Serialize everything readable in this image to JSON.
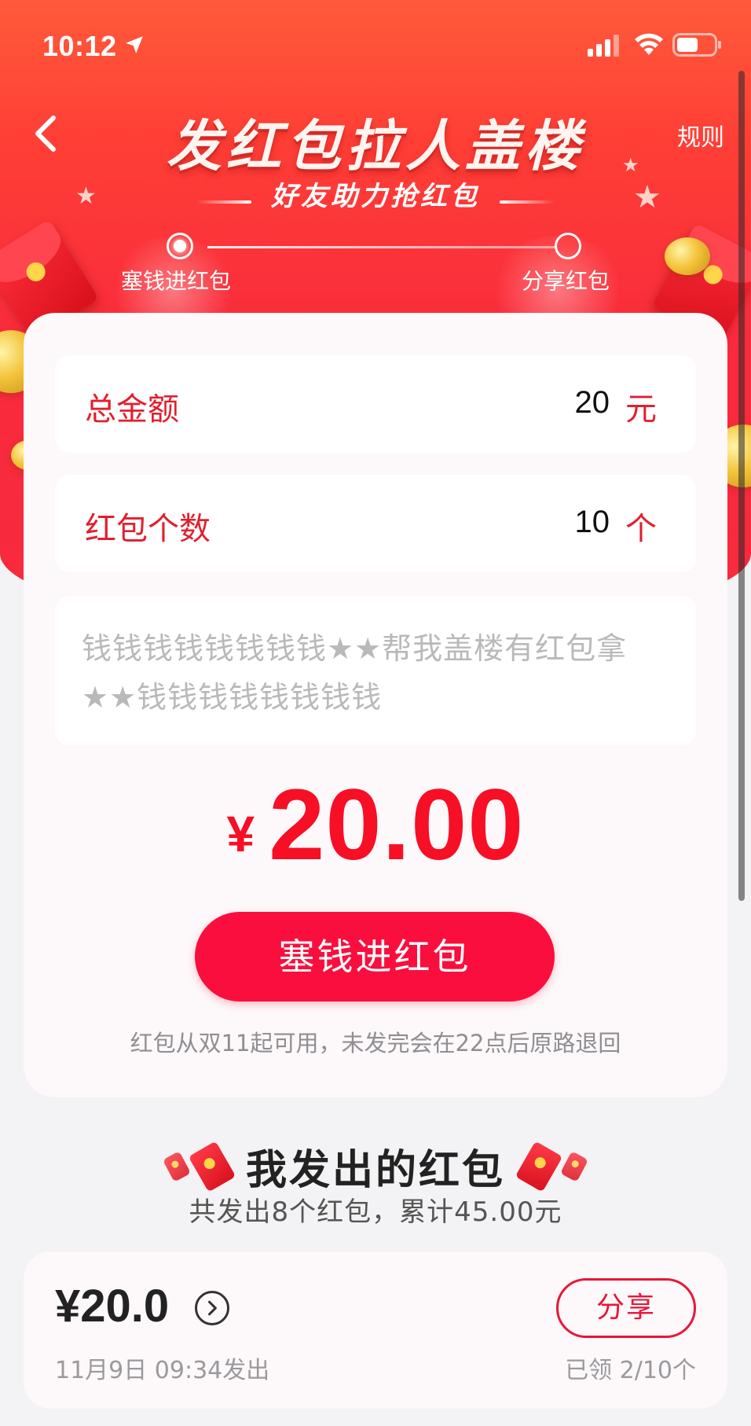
{
  "status_bar": {
    "time": "10:12"
  },
  "nav": {
    "rules_label": "规则"
  },
  "hero": {
    "title": "发红包拉人盖楼",
    "subtitle": "好友助力抢红包"
  },
  "steps": [
    {
      "label": "塞钱进红包",
      "active": true
    },
    {
      "label": "分享红包",
      "active": false
    }
  ],
  "form": {
    "total_amount": {
      "label": "总金额",
      "value": "20",
      "unit": "元"
    },
    "packet_count": {
      "label": "红包个数",
      "value": "10",
      "unit": "个"
    },
    "message": "钱钱钱钱钱钱钱钱★★帮我盖楼有红包拿★★钱钱钱钱钱钱钱钱"
  },
  "summary": {
    "currency_symbol": "¥",
    "amount": "20.00"
  },
  "primary_button_label": "塞钱进红包",
  "note": "红包从双11起可用，未发完会在22点后原路退回",
  "sent_section": {
    "title": "我发出的红包",
    "summary": "共发出8个红包，累计45.00元",
    "records": [
      {
        "amount": "¥20.0",
        "time": "11月9日 09:34发出",
        "share_label": "分享",
        "claimed": "已领 2/10个"
      }
    ]
  },
  "colors": {
    "brand_red": "#fa0e3d",
    "label_red": "#e21f2e",
    "hero_top": "#ff5a3a",
    "hero_bottom": "#f72a3e"
  }
}
